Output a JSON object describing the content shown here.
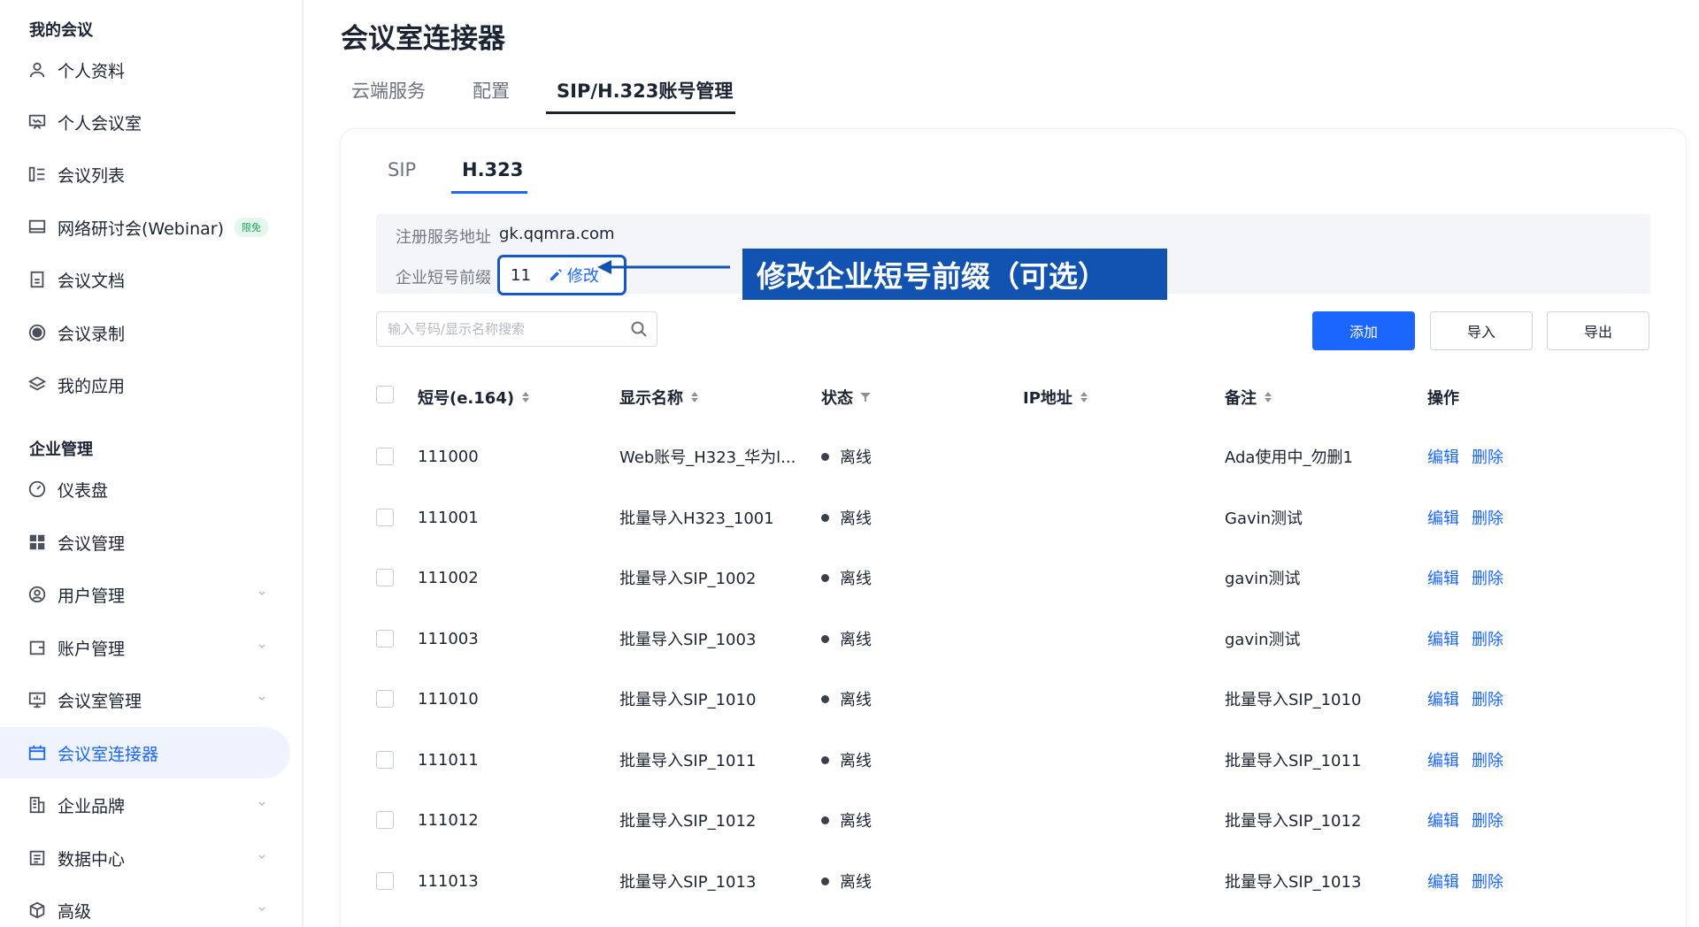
{
  "sidebar": {
    "section_my_meetings": "我的会议",
    "section_enterprise": "企业管理",
    "items": [
      {
        "label": "个人资料",
        "icon": "user-icon"
      },
      {
        "label": "个人会议室",
        "icon": "presentation-icon"
      },
      {
        "label": "会议列表",
        "icon": "list-icon"
      },
      {
        "label": "网络研讨会(Webinar)",
        "icon": "monitor-icon",
        "badge": "限免"
      },
      {
        "label": "会议文档",
        "icon": "document-icon"
      },
      {
        "label": "会议录制",
        "icon": "record-icon"
      },
      {
        "label": "我的应用",
        "icon": "layers-icon"
      },
      {
        "label": "仪表盘",
        "icon": "dashboard-icon"
      },
      {
        "label": "会议管理",
        "icon": "grid-icon"
      },
      {
        "label": "用户管理",
        "icon": "user-circle-icon"
      },
      {
        "label": "账户管理",
        "icon": "wallet-icon"
      },
      {
        "label": "会议室管理",
        "icon": "room-icon"
      },
      {
        "label": "会议室连接器",
        "icon": "connector-icon"
      },
      {
        "label": "企业品牌",
        "icon": "building-icon"
      },
      {
        "label": "数据中心",
        "icon": "data-icon"
      },
      {
        "label": "高级",
        "icon": "cube-icon"
      }
    ]
  },
  "page": {
    "title": "会议室连接器",
    "tabs": [
      "云端服务",
      "配置",
      "SIP/H.323账号管理"
    ],
    "active_tab": "SIP/H.323账号管理"
  },
  "subtabs": [
    "SIP",
    "H.323"
  ],
  "info": {
    "server_label": "注册服务地址",
    "server_value": "gk.qqmra.com",
    "prefix_label": "企业短号前缀",
    "prefix_value": "11",
    "edit_label": "修改"
  },
  "annotation": "修改企业短号前缀（可选）",
  "search": {
    "placeholder": "输入号码/显示名称搜索"
  },
  "buttons": {
    "add": "添加",
    "import": "导入",
    "export": "导出"
  },
  "table": {
    "headers": [
      "短号(e.164)",
      "显示名称",
      "状态",
      "IP地址",
      "备注",
      "操作"
    ],
    "rows": [
      {
        "number": "111000",
        "name": "Web账号_H323_华为l...",
        "status": "离线",
        "ip": "",
        "remark": "Ada使用中_勿删1"
      },
      {
        "number": "111001",
        "name": "批量导入H323_1001",
        "status": "离线",
        "ip": "",
        "remark": "Gavin测试"
      },
      {
        "number": "111002",
        "name": "批量导入SIP_1002",
        "status": "离线",
        "ip": "",
        "remark": "gavin测试"
      },
      {
        "number": "111003",
        "name": "批量导入SIP_1003",
        "status": "离线",
        "ip": "",
        "remark": "gavin测试"
      },
      {
        "number": "111010",
        "name": "批量导入SIP_1010",
        "status": "离线",
        "ip": "",
        "remark": "批量导入SIP_1010"
      },
      {
        "number": "111011",
        "name": "批量导入SIP_1011",
        "status": "离线",
        "ip": "",
        "remark": "批量导入SIP_1011"
      },
      {
        "number": "111012",
        "name": "批量导入SIP_1012",
        "status": "离线",
        "ip": "",
        "remark": "批量导入SIP_1012"
      },
      {
        "number": "111013",
        "name": "批量导入SIP_1013",
        "status": "离线",
        "ip": "",
        "remark": "批量导入SIP_1013"
      }
    ],
    "action_edit": "编辑",
    "action_delete": "删除"
  },
  "colors": {
    "accent": "#1a66ff",
    "annotation_bg": "#1252b0",
    "active_nav_bg": "#eef3fe"
  }
}
